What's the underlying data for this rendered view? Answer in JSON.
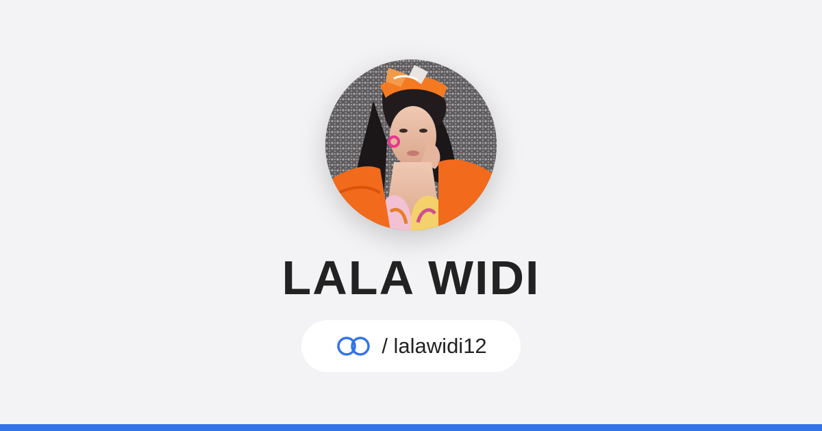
{
  "profile": {
    "name": "LALA WIDI",
    "handle": "/ lalawidi12",
    "avatar_alt": "LALA WIDI"
  },
  "icons": {
    "brand_logo": "linked-rings-icon"
  },
  "colors": {
    "background": "#f3f3f5",
    "accent": "#3273e8",
    "name_text": "#222222",
    "pill_bg": "#ffffff"
  }
}
